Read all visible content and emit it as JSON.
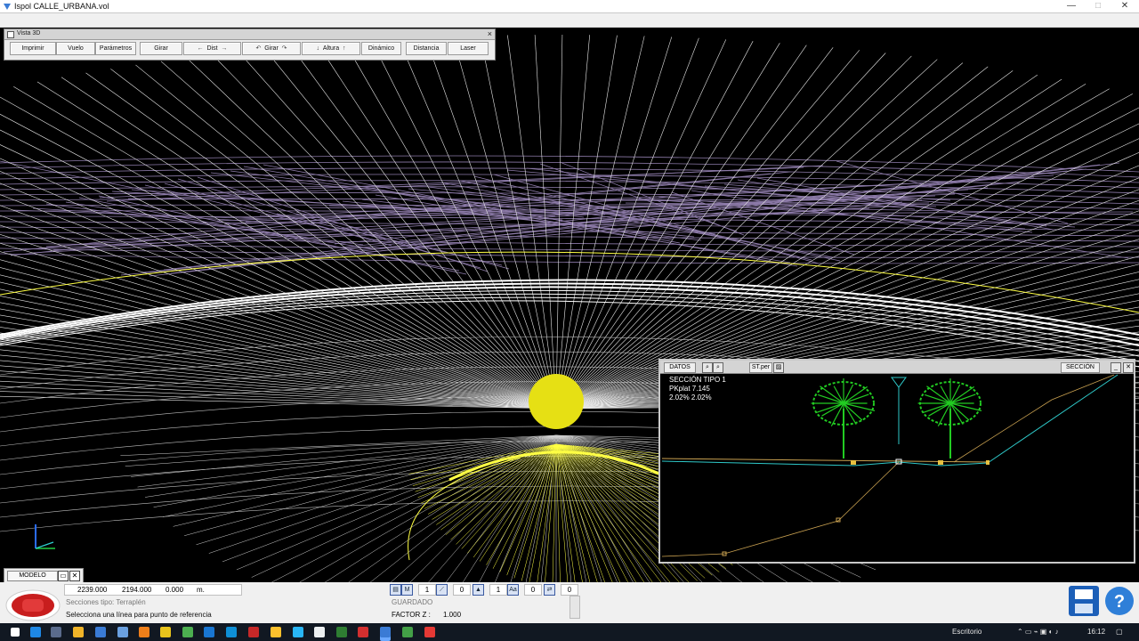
{
  "window": {
    "title": "Ispol  CALLE_URBANA.vol",
    "minimize": "—",
    "maximize": "□",
    "close": "✕"
  },
  "vista3d": {
    "title": "Vista 3D",
    "close": "×",
    "buttons": {
      "imprimir": "Imprimir",
      "vuelo": "Vuelo",
      "parametros": "Parámetros",
      "girar": "Girar",
      "dist": "Dist",
      "girar2": "Girar",
      "altura": "Altura",
      "dinamico": "Dinámico",
      "distancia": "Distancia",
      "laser": "Laser"
    }
  },
  "modelo": {
    "tab": "MODELO"
  },
  "statusbar": {
    "coords": {
      "x": "2239.000",
      "y": "2194.000",
      "z": "0.000",
      "unit": "m."
    },
    "line1": "Secciones tipo: Terraplén",
    "line2": "Selecciona una línea para punto de referencia",
    "saved": "GUARDADO",
    "factor_label": "FACTOR Z :",
    "factor_value": "1.000",
    "num1": "1",
    "num2": "0",
    "num3": "1",
    "num4": "0",
    "num5": "0",
    "m_label": "M",
    "aa_label": "Aa"
  },
  "section": {
    "datos": "DATOS",
    "st_file": "ST.per",
    "seccion": "SECCIÓN",
    "title": "SECCIÓN TIPO 1",
    "pk": "PKplat 7.145",
    "slopes": "2.02%  2.02%"
  },
  "taskbar": {
    "escritorio": "Escritorio",
    "time": "16:12"
  },
  "colors": {
    "terrain": "#ffffff",
    "road": "#ffff44",
    "mesh": "#8c7aa8",
    "tree": "#22cc22",
    "cyan_line": "#2ec8c8",
    "ground_line": "#c8a050"
  }
}
